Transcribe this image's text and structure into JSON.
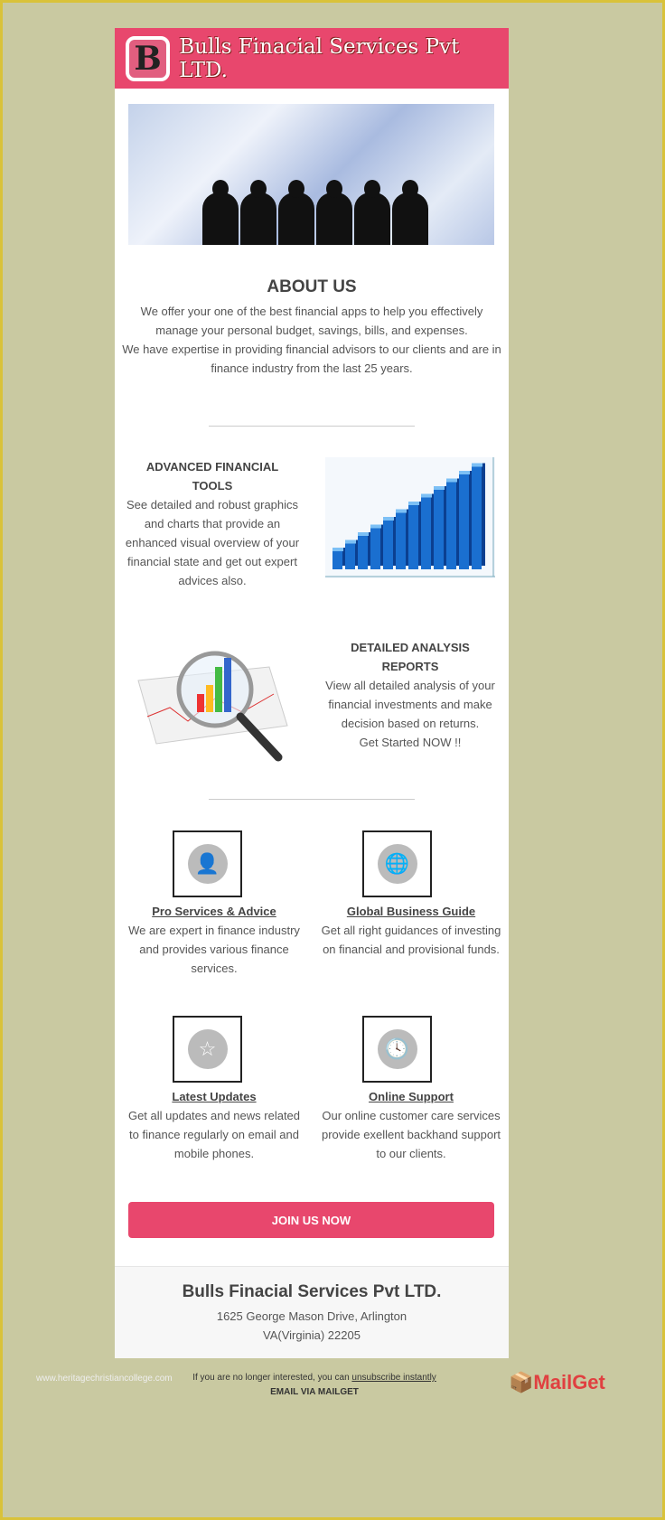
{
  "header": {
    "logo_letter": "B",
    "brand": "Bulls Finacial Services Pvt LTD."
  },
  "about": {
    "title": "ABOUT US",
    "lines": [
      "We offer your one of the best financial apps to help you effectively",
      "manage your personal budget, savings, bills, and expenses.",
      "We have expertise in providing financial advisors to our clients and are in",
      "finance industry from the last 25 years."
    ]
  },
  "tools": {
    "title_lines": [
      "ADVANCED FINANCIAL",
      "TOOLS"
    ],
    "lines": [
      "See detailed and robust graphics",
      "and charts that provide an",
      "enhanced visual overview of your",
      "financial state and get out expert",
      "advices also."
    ]
  },
  "reports": {
    "title_lines": [
      "DETAILED ANALYSIS",
      "REPORTS"
    ],
    "lines": [
      "View all detailed analysis of your",
      "financial investments and make",
      "decision based on returns.",
      "Get Started NOW !!"
    ]
  },
  "features": [
    {
      "icon": "user-icon",
      "glyph": "👤",
      "title": "Pro Services & Advice",
      "lines": [
        "We are expert in finance industry",
        "and provides various finance",
        "services."
      ]
    },
    {
      "icon": "globe-icon",
      "glyph": "🌐",
      "title": "Global Business Guide",
      "lines": [
        "Get all right guidances of investing",
        "on financial and provisional funds."
      ]
    },
    {
      "icon": "star-icon",
      "glyph": "☆",
      "title": "Latest Updates",
      "lines": [
        "Get all updates and news related",
        "to finance regularly on email and",
        "mobile phones."
      ]
    },
    {
      "icon": "clock-icon",
      "glyph": "🕓",
      "title": "Online Support",
      "lines": [
        "Our online customer care services",
        "provide exellent backhand support",
        "to our clients."
      ]
    }
  ],
  "cta": "JOIN US NOW",
  "footer": {
    "company": "Bulls Finacial Services Pvt LTD.",
    "address1": "1625 George Mason Drive, Arlington",
    "address2": "VA(Virginia) 22205"
  },
  "bottom": {
    "watermark": "www.heritagechristiancollege.com",
    "unsub_prefix": "If you are no longer interested, you can ",
    "unsub_link": "unsubscribe instantly",
    "via": "EMAIL VIA MAILGET",
    "mailget": "MailGet"
  },
  "colors": {
    "accent": "#e8476d",
    "background": "#c9c9a1"
  }
}
